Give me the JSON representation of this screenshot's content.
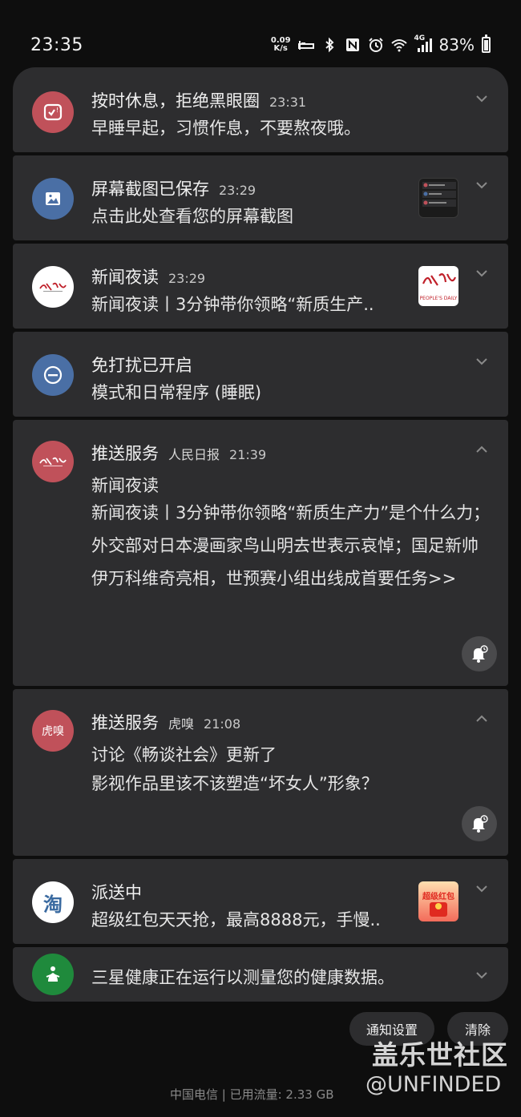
{
  "status_bar": {
    "time": "23:35",
    "net_speed_top": "0.09",
    "net_speed_bottom": "K/s",
    "network_type": "4G",
    "battery": "83%",
    "icons": [
      "sleep-icon",
      "bluetooth-icon",
      "nfc-icon",
      "alarm-icon",
      "wifi-icon",
      "signal-icon",
      "battery-icon"
    ]
  },
  "notifications": [
    {
      "title": "按时休息，拒绝黑眼圈",
      "time": "23:31",
      "body": "早睡早起，习惯作息，不要熬夜哦。",
      "icon": "bedtime-check-icon",
      "icon_color": "#c0515a"
    },
    {
      "title": "屏幕截图已保存",
      "time": "23:29",
      "body": "点击此处查看您的屏幕截图",
      "icon": "image-icon",
      "icon_color": "#4a6fa5"
    },
    {
      "title": "新闻夜读",
      "time": "23:29",
      "body": "新闻夜读丨3分钟带你领略“新质生产..",
      "icon": "peoples-daily-logo",
      "icon_color": "#ffffff",
      "thumb_caption": "PEOPLE'S DAILY"
    },
    {
      "title": "免打扰已开启",
      "body": "模式和日常程序 (睡眠)",
      "icon": "do-not-disturb-icon",
      "icon_color": "#4a6fa5"
    },
    {
      "title": "推送服务",
      "sub_app": "人民日报",
      "time": "21:39",
      "headline": "新闻夜读",
      "body": "新闻夜读丨3分钟带你领略“新质生产力”是个什么力；外交部对日本漫画家鸟山明去世表示哀悼；国足新帅伊万科维奇亮相，世预赛小组出线成首要任务>>",
      "icon": "peoples-daily-logo",
      "icon_color": "#c0515a"
    },
    {
      "title": "推送服务",
      "sub_app": "虎嗅",
      "time": "21:08",
      "headline": "讨论《畅谈社会》更新了",
      "body": "影视作品里该不该塑造“坏女人”形象？",
      "icon": "huxiu-logo",
      "icon_color": "#c0515a",
      "icon_text": "虎嗅"
    },
    {
      "title": "派送中",
      "body": "超级红包天天抢，最高8888元，手慢..",
      "icon": "taobao-logo",
      "icon_color": "#ffffff",
      "icon_text": "淘",
      "thumb_text": "超级红包"
    },
    {
      "body": "三星健康正在运行以测量您的健康数据。",
      "icon": "samsung-health-icon",
      "icon_color": "#1f8a3c"
    }
  ],
  "actions": {
    "settings": "通知设置",
    "clear": "清除"
  },
  "footer": {
    "carrier": "中国电信 | 已用流量: 2.33 GB"
  },
  "watermark": {
    "line1": "盖乐世社区",
    "line2": "@UNFINDED"
  }
}
